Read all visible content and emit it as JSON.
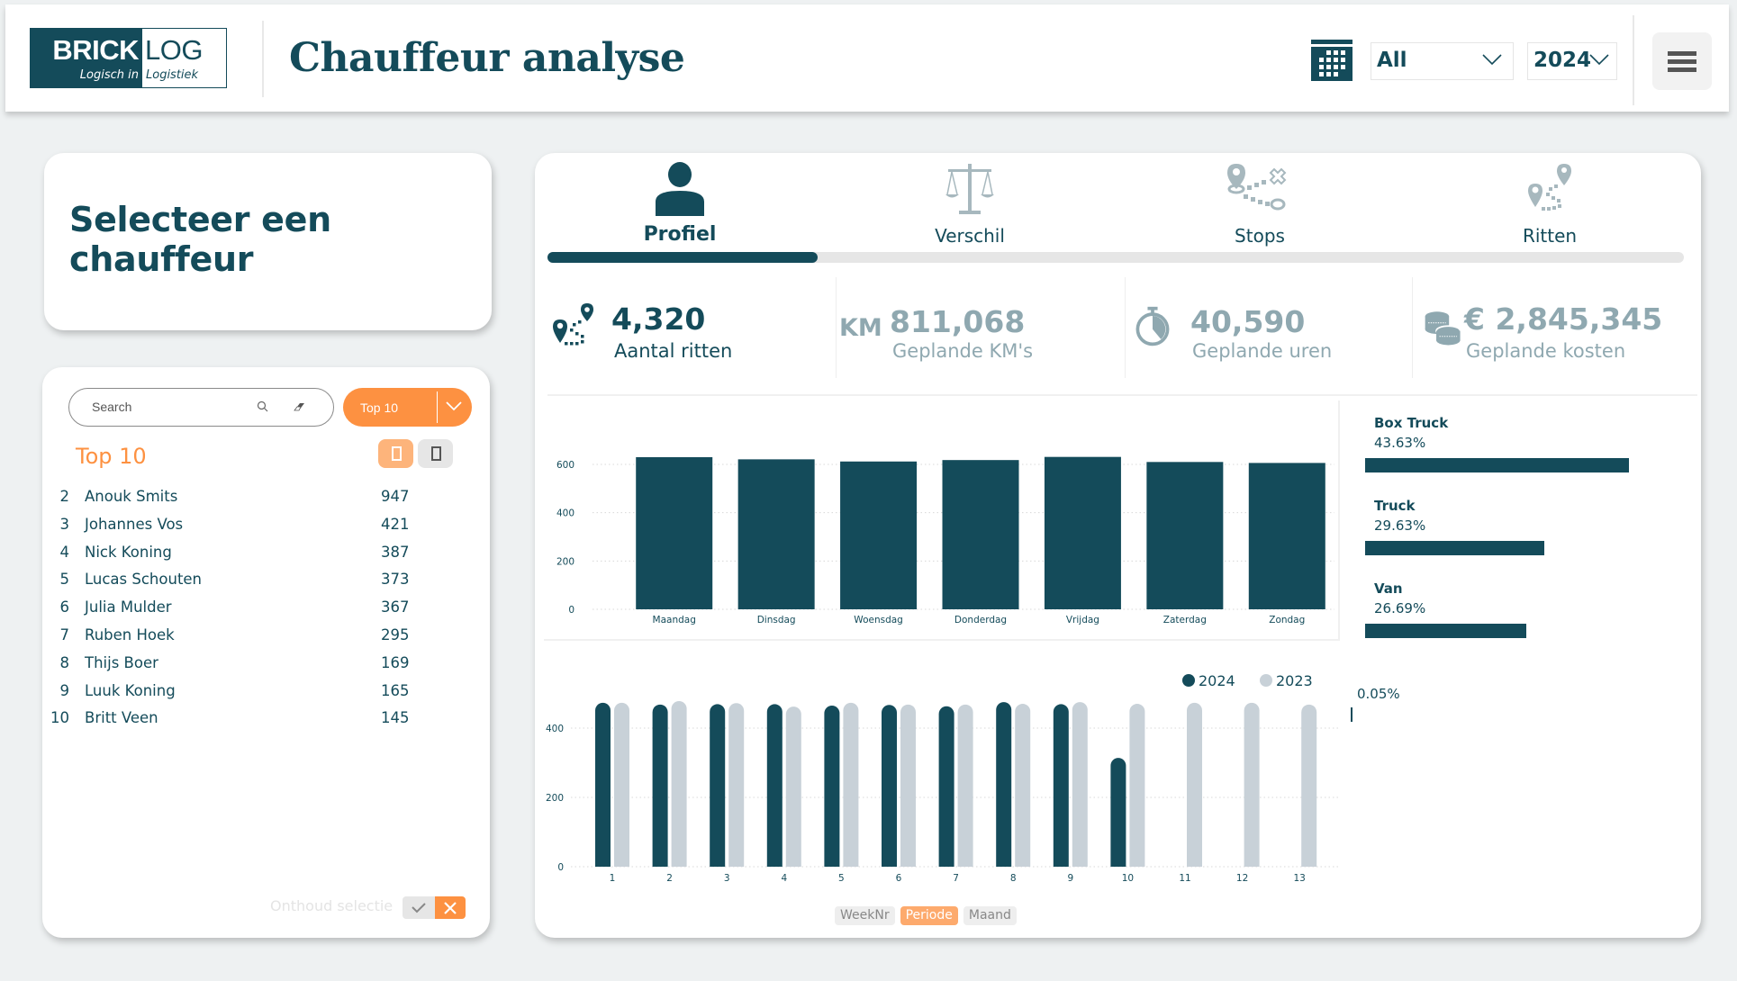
{
  "header": {
    "logo": {
      "left_word": "BRICK",
      "right_word": "LOG",
      "left_tagline": "Logisch in",
      "right_tagline": "Logistiek"
    },
    "title": "Chauffeur analyse",
    "calendar_icon": "calendar-icon",
    "period_select": {
      "value": "All"
    },
    "year_select": {
      "value": "2024"
    },
    "menu_icon": "hamburger-menu-icon"
  },
  "colors": {
    "primary": "#144b5a",
    "accent": "#fd9141",
    "muted": "#8fa8b0",
    "series_2023": "#c8d1d8",
    "background": "#eef1f2"
  },
  "left": {
    "select_title": "Selecteer een chauffeur",
    "search": {
      "placeholder": "Search"
    },
    "top_dropdown": {
      "value": "Top 10"
    },
    "list_title": "Top 10",
    "drivers": [
      {
        "rank": "2",
        "name": "Anouk Smits",
        "count": "947"
      },
      {
        "rank": "3",
        "name": "Johannes Vos",
        "count": "421"
      },
      {
        "rank": "4",
        "name": "Nick Koning",
        "count": "387"
      },
      {
        "rank": "5",
        "name": "Lucas Schouten",
        "count": "373"
      },
      {
        "rank": "6",
        "name": "Julia Mulder",
        "count": "367"
      },
      {
        "rank": "7",
        "name": "Ruben Hoek",
        "count": "295"
      },
      {
        "rank": "8",
        "name": "Thijs Boer",
        "count": "169"
      },
      {
        "rank": "9",
        "name": "Luuk Koning",
        "count": "165"
      },
      {
        "rank": "10",
        "name": "Britt Veen",
        "count": "145"
      }
    ],
    "remember_label": "Onthoud selectie"
  },
  "tabs": [
    {
      "label": "Profiel",
      "icon": "person-icon",
      "active": true
    },
    {
      "label": "Verschil",
      "icon": "scales-icon",
      "active": false
    },
    {
      "label": "Stops",
      "icon": "route-stops-icon",
      "active": false
    },
    {
      "label": "Ritten",
      "icon": "route-trips-icon",
      "active": false
    }
  ],
  "tab_progress_fraction": 0.25,
  "kpis": [
    {
      "value": "4,320",
      "label": "Aantal ritten",
      "icon": "route-icon"
    },
    {
      "value": "811,068",
      "label": "Geplande KM's",
      "icon": "km-icon",
      "prefix": "KM"
    },
    {
      "value": "40,590",
      "label": "Geplande uren",
      "icon": "stopwatch-icon"
    },
    {
      "value": "€ 2,845,345",
      "label": "Geplande kosten",
      "icon": "coins-icon"
    }
  ],
  "vehicle_types": [
    {
      "name": "Box Truck",
      "percent_label": "43.63%",
      "percent": 43.63
    },
    {
      "name": "Truck",
      "percent_label": "29.63%",
      "percent": 29.63
    },
    {
      "name": "Van",
      "percent_label": "26.69%",
      "percent": 26.69
    },
    {
      "name": "",
      "percent_label": "0.05%",
      "percent": 0.05
    }
  ],
  "bottom_toggle": [
    {
      "label": "WeekNr",
      "active": false
    },
    {
      "label": "Periode",
      "active": true
    },
    {
      "label": "Maand",
      "active": false
    }
  ],
  "chart_data": [
    {
      "type": "bar",
      "title": "",
      "categories": [
        "Maandag",
        "Dinsdag",
        "Woensdag",
        "Donderdag",
        "Vrijdag",
        "Zaterdag",
        "Zondag"
      ],
      "values": [
        630,
        621,
        612,
        618,
        631,
        610,
        606
      ],
      "xlabel": "",
      "ylabel": "",
      "ylim": [
        0,
        700
      ],
      "yticks": [
        0,
        200,
        400,
        600
      ],
      "grid": true
    },
    {
      "type": "bar",
      "title": "",
      "categories": [
        "1",
        "2",
        "3",
        "4",
        "5",
        "6",
        "7",
        "8",
        "9",
        "10",
        "11",
        "12",
        "13"
      ],
      "series": [
        {
          "name": "2024",
          "values": [
            473,
            468,
            469,
            469,
            465,
            467,
            463,
            475,
            469,
            314,
            null,
            null,
            null
          ]
        },
        {
          "name": "2023",
          "values": [
            473,
            478,
            472,
            462,
            473,
            468,
            468,
            470,
            475,
            470,
            473,
            473,
            468
          ]
        }
      ],
      "legend": [
        "2024",
        "2023"
      ],
      "legend_position": "top-right",
      "xlabel": "",
      "ylabel": "",
      "ylim": [
        0,
        520
      ],
      "yticks": [
        0,
        200,
        400
      ],
      "grid": true
    }
  ]
}
